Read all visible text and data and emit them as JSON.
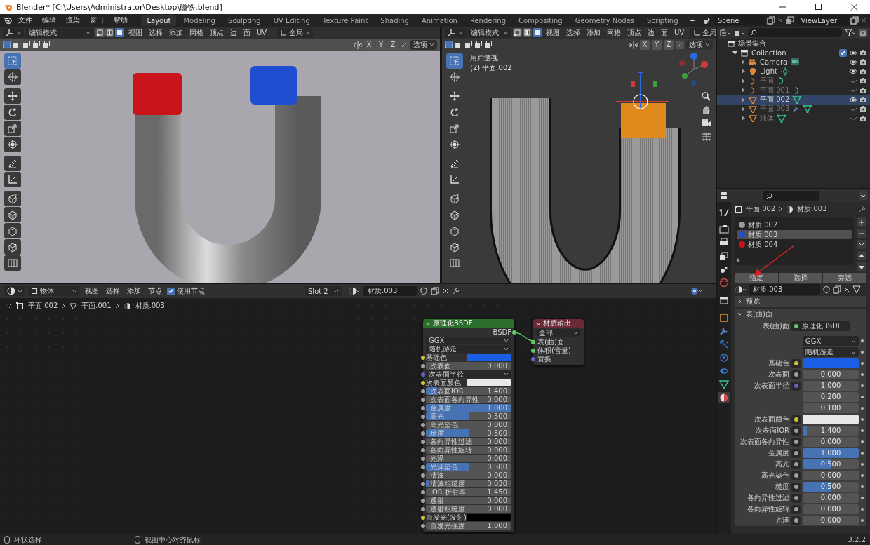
{
  "window": {
    "title": "Blender* [C:\\Users\\Administrator\\Desktop\\磁铁.blend]"
  },
  "top_bar": {
    "menus": [
      "文件",
      "编辑",
      "渲染",
      "窗口",
      "帮助"
    ],
    "workspaces": [
      {
        "label": "Layout",
        "selected": true
      },
      {
        "label": "Modeling",
        "selected": false
      },
      {
        "label": "Sculpting",
        "selected": false
      },
      {
        "label": "UV Editing",
        "selected": false
      },
      {
        "label": "Texture Paint",
        "selected": false
      },
      {
        "label": "Shading",
        "selected": false
      },
      {
        "label": "Animation",
        "selected": false
      },
      {
        "label": "Rendering",
        "selected": false
      },
      {
        "label": "Compositing",
        "selected": false
      },
      {
        "label": "Geometry Nodes",
        "selected": false
      },
      {
        "label": "Scripting",
        "selected": false
      }
    ],
    "add_workspace": "+",
    "scene": "Scene",
    "view_layer": "ViewLayer"
  },
  "viewports": [
    {
      "kind": "render",
      "mode": "编辑模式",
      "select_modes": [
        {
          "selected": false
        },
        {
          "selected": false
        },
        {
          "selected": true
        }
      ],
      "menus": [
        "视图",
        "选择",
        "添加",
        "网格",
        "顶点",
        "边",
        "面",
        "UV"
      ],
      "orientation": "全局",
      "axes": [
        "X",
        "Y",
        "Z"
      ],
      "options": "选项",
      "tools": [
        {
          "kind": "select_box",
          "selected": true
        },
        {
          "kind": "cursor",
          "selected": false
        },
        {
          "kind": "move",
          "selected": false
        },
        {
          "kind": "rotate",
          "selected": false
        },
        {
          "kind": "scale",
          "selected": false
        },
        {
          "kind": "transform",
          "selected": false
        },
        {
          "kind": "annotate",
          "selected": false
        },
        {
          "kind": "measure",
          "selected": false
        },
        {
          "kind": "add_cube",
          "selected": false
        },
        {
          "kind": "extrude",
          "selected": false
        },
        {
          "kind": "inset",
          "selected": false
        },
        {
          "kind": "bevel",
          "selected": false
        },
        {
          "kind": "loop_cut",
          "selected": false
        }
      ]
    },
    {
      "kind": "wireframe",
      "mode": "编辑模式",
      "select_modes": [
        {
          "selected": false
        },
        {
          "selected": false
        },
        {
          "selected": true
        }
      ],
      "menus": [
        "视图",
        "选择",
        "添加",
        "网格",
        "顶点",
        "边",
        "面",
        "UV"
      ],
      "orientation": "全局",
      "axes": [
        "X",
        "Y",
        "Z"
      ],
      "options": "选项",
      "view_name": "用户透视",
      "object_label": "(2) 平面.002",
      "tools": [
        {
          "kind": "select_box",
          "selected": true
        },
        {
          "kind": "cursor",
          "selected": false
        },
        {
          "kind": "move",
          "selected": false
        },
        {
          "kind": "rotate",
          "selected": false
        },
        {
          "kind": "scale",
          "selected": false
        },
        {
          "kind": "transform",
          "selected": false
        },
        {
          "kind": "annotate",
          "selected": false
        },
        {
          "kind": "measure",
          "selected": false
        },
        {
          "kind": "add_cube",
          "selected": false
        },
        {
          "kind": "extrude",
          "selected": false
        },
        {
          "kind": "inset",
          "selected": false
        },
        {
          "kind": "bevel",
          "selected": false
        },
        {
          "kind": "loop_cut",
          "selected": false
        }
      ]
    }
  ],
  "outliner": {
    "root": "场景集合",
    "items": [
      {
        "name": "Collection",
        "kind": "collection",
        "expanded": true,
        "visible": true,
        "checked": true,
        "children": [
          {
            "name": "Camera",
            "kind": "camera",
            "visible": true,
            "selected": false
          },
          {
            "name": "Light",
            "kind": "light",
            "visible": true,
            "selected": false
          },
          {
            "name": "平面",
            "kind": "curve",
            "visible": false,
            "selected": false
          },
          {
            "name": "平面.001",
            "kind": "curve",
            "visible": false,
            "selected": false
          },
          {
            "name": "平面.002",
            "kind": "mesh",
            "visible": true,
            "selected": true
          },
          {
            "name": "平面.003",
            "kind": "mesh",
            "visible": false,
            "selected": false,
            "modifier": true
          },
          {
            "name": "球体",
            "kind": "mesh",
            "visible": false,
            "selected": false
          }
        ]
      }
    ]
  },
  "properties": {
    "tabs": [
      {
        "kind": "tool",
        "selected": false
      },
      {
        "kind": "render",
        "selected": false
      },
      {
        "kind": "output",
        "selected": false
      },
      {
        "kind": "view_layer",
        "selected": false
      },
      {
        "kind": "scene",
        "selected": false
      },
      {
        "kind": "world",
        "selected": false
      },
      {
        "kind": "collection",
        "selected": false
      },
      {
        "kind": "object",
        "selected": false
      },
      {
        "kind": "modifier",
        "selected": false
      },
      {
        "kind": "particles",
        "selected": false
      },
      {
        "kind": "physics",
        "selected": false
      },
      {
        "kind": "constraints",
        "selected": false
      },
      {
        "kind": "data",
        "selected": false
      },
      {
        "kind": "material",
        "selected": true
      }
    ],
    "breadcrumb": [
      "平面.002",
      "材质.003"
    ],
    "slots": [
      {
        "name": "材质.002",
        "color": "#9a9a9a",
        "selected": false
      },
      {
        "name": "材质.003",
        "color": "#1b4fd0",
        "selected": true
      },
      {
        "name": "材质.004",
        "color": "#c81414",
        "selected": false
      }
    ],
    "slot_buttons": [
      "指定",
      "选择",
      "弃选"
    ],
    "material": "材质.003",
    "panels": [
      {
        "title": "预览",
        "expanded": false
      },
      {
        "title": "表(曲)面",
        "expanded": true
      }
    ],
    "surface": {
      "label": "表(曲)面",
      "shader": "原理化BSDF",
      "dropdowns": [
        "GGX",
        "随机游走"
      ],
      "rows": [
        {
          "label": "基础色",
          "kind": "color",
          "color": "#1a5ee6"
        },
        {
          "label": "次表面",
          "kind": "slider",
          "value": "0.000",
          "level": 0
        },
        {
          "label": "次表面半径",
          "kind": "vector",
          "values": [
            "1.000",
            "0.200",
            "0.100"
          ]
        },
        {
          "label": "次表面颜色",
          "kind": "color",
          "color": "#e8e8e8"
        },
        {
          "label": "次表面IOR",
          "kind": "slider",
          "value": "1.400",
          "level": 0.08
        },
        {
          "label": "次表面各向异性",
          "kind": "slider",
          "value": "0.000",
          "level": 0
        },
        {
          "label": "金属度",
          "kind": "slider",
          "value": "1.000",
          "level": 1
        },
        {
          "label": "高光",
          "kind": "slider",
          "value": "0.500",
          "level": 0.5
        },
        {
          "label": "高光染色",
          "kind": "slider",
          "value": "0.000",
          "level": 0
        },
        {
          "label": "糙度",
          "kind": "slider",
          "value": "0.500",
          "level": 0.5
        },
        {
          "label": "各向异性过滤",
          "kind": "slider",
          "value": "0.000",
          "level": 0
        },
        {
          "label": "各向异性旋转",
          "kind": "slider",
          "value": "0.000",
          "level": 0
        },
        {
          "label": "光泽",
          "kind": "slider",
          "value": "0.000",
          "level": 0
        }
      ]
    }
  },
  "node_editor": {
    "mode": "物体",
    "menus": [
      "视图",
      "选择",
      "添加",
      "节点"
    ],
    "use_nodes": {
      "label": "使用节点",
      "checked": true
    },
    "slot": "Slot 2",
    "material": "材质.003",
    "breadcrumb": [
      "平面.002",
      "平面.001",
      "材质.003"
    ],
    "bsdf_node": {
      "title": "原理化BSDF",
      "output": "BSDF",
      "dropdowns": [
        "GGX",
        "随机游走"
      ],
      "inputs": [
        {
          "label": "基础色",
          "kind": "color",
          "color": "#1a5ee6"
        },
        {
          "label": "次表面",
          "kind": "slider",
          "value": "0.000",
          "level": 0
        },
        {
          "label": "次表面半径",
          "kind": "vector"
        },
        {
          "label": "次表面颜色",
          "kind": "color",
          "color": "#e8e8e8"
        },
        {
          "label": "次表面IOR",
          "kind": "slider",
          "value": "1.400",
          "level": 0.13
        },
        {
          "label": "次表面各向异性",
          "kind": "slider",
          "value": "0.000",
          "level": 0
        },
        {
          "label": "金属度",
          "kind": "slider",
          "value": "1.000",
          "level": 1
        },
        {
          "label": "高光",
          "kind": "slider",
          "value": "0.500",
          "level": 0.5
        },
        {
          "label": "高光染色",
          "kind": "slider",
          "value": "0.000",
          "level": 0
        },
        {
          "label": "糙度",
          "kind": "slider",
          "value": "0.500",
          "level": 0.5
        },
        {
          "label": "各向异性过滤",
          "kind": "slider",
          "value": "0.000",
          "level": 0
        },
        {
          "label": "各向异性旋转",
          "kind": "slider",
          "value": "0.000",
          "level": 0
        },
        {
          "label": "光泽",
          "kind": "slider",
          "value": "0.000",
          "level": 0
        },
        {
          "label": "光泽染色",
          "kind": "slider",
          "value": "0.500",
          "level": 0.5
        },
        {
          "label": "清漆",
          "kind": "slider",
          "value": "0.000",
          "level": 0
        },
        {
          "label": "清漆粗糙度",
          "kind": "slider",
          "value": "0.030",
          "level": 0.03
        },
        {
          "label": "IOR 折射率",
          "kind": "slider",
          "value": "1.450",
          "level": 0
        },
        {
          "label": "透射",
          "kind": "slider",
          "value": "0.000",
          "level": 0
        },
        {
          "label": "透射粗糙度",
          "kind": "slider",
          "value": "0.000",
          "level": 0
        },
        {
          "label": "自发光(发射)",
          "kind": "color",
          "color": "#000000"
        },
        {
          "label": "自发光强度",
          "kind": "slider",
          "value": "1.000",
          "level": 0
        }
      ]
    },
    "output_node": {
      "title": "材质输出",
      "target": "全部",
      "inputs": [
        {
          "label": "表(曲)面",
          "kind": "shader"
        },
        {
          "label": "体积(音量)",
          "kind": "shader"
        },
        {
          "label": "置换",
          "kind": "vector"
        }
      ]
    }
  },
  "status_bar": {
    "items": [
      "环状选择",
      "视图中心对齐鼠标"
    ],
    "version": "3.2.2"
  }
}
